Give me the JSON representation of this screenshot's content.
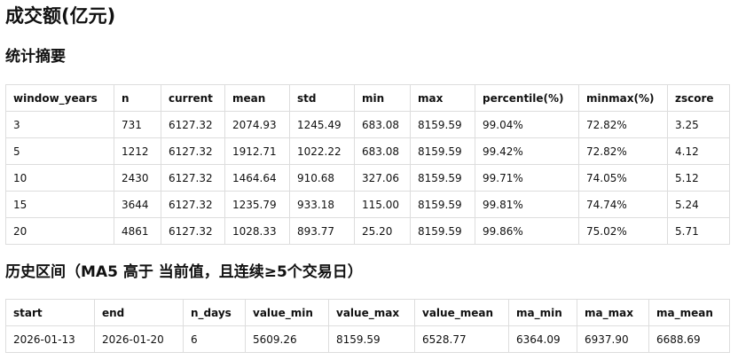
{
  "title": "成交额(亿元)",
  "summary": {
    "heading": "统计摘要",
    "columns": [
      "window_years",
      "n",
      "current",
      "mean",
      "std",
      "min",
      "max",
      "percentile(%)",
      "minmax(%)",
      "zscore"
    ],
    "rows": [
      [
        "3",
        "731",
        "6127.32",
        "2074.93",
        "1245.49",
        "683.08",
        "8159.59",
        "99.04%",
        "72.82%",
        "3.25"
      ],
      [
        "5",
        "1212",
        "6127.32",
        "1912.71",
        "1022.22",
        "683.08",
        "8159.59",
        "99.42%",
        "72.82%",
        "4.12"
      ],
      [
        "10",
        "2430",
        "6127.32",
        "1464.64",
        "910.68",
        "327.06",
        "8159.59",
        "99.71%",
        "74.05%",
        "5.12"
      ],
      [
        "15",
        "3644",
        "6127.32",
        "1235.79",
        "933.18",
        "115.00",
        "8159.59",
        "99.81%",
        "74.74%",
        "5.24"
      ],
      [
        "20",
        "4861",
        "6127.32",
        "1028.33",
        "893.77",
        "25.20",
        "8159.59",
        "99.86%",
        "75.02%",
        "5.71"
      ]
    ]
  },
  "history": {
    "heading": "历史区间（MA5 高于 当前值，且连续≥5个交易日）",
    "columns": [
      "start",
      "end",
      "n_days",
      "value_min",
      "value_max",
      "value_mean",
      "ma_min",
      "ma_max",
      "ma_mean"
    ],
    "rows": [
      [
        "2026-01-13",
        "2026-01-20",
        "6",
        "5609.26",
        "8159.59",
        "6528.77",
        "6364.09",
        "6937.90",
        "6688.69"
      ]
    ]
  }
}
